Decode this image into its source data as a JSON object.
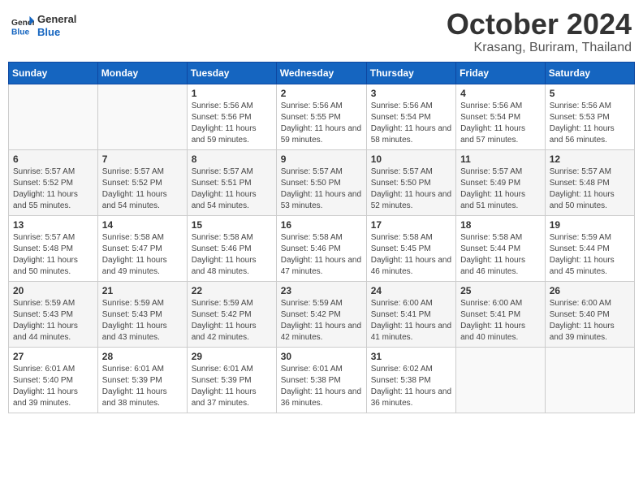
{
  "header": {
    "logo_line1": "General",
    "logo_line2": "Blue",
    "month_year": "October 2024",
    "location": "Krasang, Buriram, Thailand"
  },
  "weekdays": [
    "Sunday",
    "Monday",
    "Tuesday",
    "Wednesday",
    "Thursday",
    "Friday",
    "Saturday"
  ],
  "weeks": [
    [
      {
        "day": "",
        "info": ""
      },
      {
        "day": "",
        "info": ""
      },
      {
        "day": "1",
        "info": "Sunrise: 5:56 AM\nSunset: 5:56 PM\nDaylight: 11 hours and 59 minutes."
      },
      {
        "day": "2",
        "info": "Sunrise: 5:56 AM\nSunset: 5:55 PM\nDaylight: 11 hours and 59 minutes."
      },
      {
        "day": "3",
        "info": "Sunrise: 5:56 AM\nSunset: 5:54 PM\nDaylight: 11 hours and 58 minutes."
      },
      {
        "day": "4",
        "info": "Sunrise: 5:56 AM\nSunset: 5:54 PM\nDaylight: 11 hours and 57 minutes."
      },
      {
        "day": "5",
        "info": "Sunrise: 5:56 AM\nSunset: 5:53 PM\nDaylight: 11 hours and 56 minutes."
      }
    ],
    [
      {
        "day": "6",
        "info": "Sunrise: 5:57 AM\nSunset: 5:52 PM\nDaylight: 11 hours and 55 minutes."
      },
      {
        "day": "7",
        "info": "Sunrise: 5:57 AM\nSunset: 5:52 PM\nDaylight: 11 hours and 54 minutes."
      },
      {
        "day": "8",
        "info": "Sunrise: 5:57 AM\nSunset: 5:51 PM\nDaylight: 11 hours and 54 minutes."
      },
      {
        "day": "9",
        "info": "Sunrise: 5:57 AM\nSunset: 5:50 PM\nDaylight: 11 hours and 53 minutes."
      },
      {
        "day": "10",
        "info": "Sunrise: 5:57 AM\nSunset: 5:50 PM\nDaylight: 11 hours and 52 minutes."
      },
      {
        "day": "11",
        "info": "Sunrise: 5:57 AM\nSunset: 5:49 PM\nDaylight: 11 hours and 51 minutes."
      },
      {
        "day": "12",
        "info": "Sunrise: 5:57 AM\nSunset: 5:48 PM\nDaylight: 11 hours and 50 minutes."
      }
    ],
    [
      {
        "day": "13",
        "info": "Sunrise: 5:57 AM\nSunset: 5:48 PM\nDaylight: 11 hours and 50 minutes."
      },
      {
        "day": "14",
        "info": "Sunrise: 5:58 AM\nSunset: 5:47 PM\nDaylight: 11 hours and 49 minutes."
      },
      {
        "day": "15",
        "info": "Sunrise: 5:58 AM\nSunset: 5:46 PM\nDaylight: 11 hours and 48 minutes."
      },
      {
        "day": "16",
        "info": "Sunrise: 5:58 AM\nSunset: 5:46 PM\nDaylight: 11 hours and 47 minutes."
      },
      {
        "day": "17",
        "info": "Sunrise: 5:58 AM\nSunset: 5:45 PM\nDaylight: 11 hours and 46 minutes."
      },
      {
        "day": "18",
        "info": "Sunrise: 5:58 AM\nSunset: 5:44 PM\nDaylight: 11 hours and 46 minutes."
      },
      {
        "day": "19",
        "info": "Sunrise: 5:59 AM\nSunset: 5:44 PM\nDaylight: 11 hours and 45 minutes."
      }
    ],
    [
      {
        "day": "20",
        "info": "Sunrise: 5:59 AM\nSunset: 5:43 PM\nDaylight: 11 hours and 44 minutes."
      },
      {
        "day": "21",
        "info": "Sunrise: 5:59 AM\nSunset: 5:43 PM\nDaylight: 11 hours and 43 minutes."
      },
      {
        "day": "22",
        "info": "Sunrise: 5:59 AM\nSunset: 5:42 PM\nDaylight: 11 hours and 42 minutes."
      },
      {
        "day": "23",
        "info": "Sunrise: 5:59 AM\nSunset: 5:42 PM\nDaylight: 11 hours and 42 minutes."
      },
      {
        "day": "24",
        "info": "Sunrise: 6:00 AM\nSunset: 5:41 PM\nDaylight: 11 hours and 41 minutes."
      },
      {
        "day": "25",
        "info": "Sunrise: 6:00 AM\nSunset: 5:41 PM\nDaylight: 11 hours and 40 minutes."
      },
      {
        "day": "26",
        "info": "Sunrise: 6:00 AM\nSunset: 5:40 PM\nDaylight: 11 hours and 39 minutes."
      }
    ],
    [
      {
        "day": "27",
        "info": "Sunrise: 6:01 AM\nSunset: 5:40 PM\nDaylight: 11 hours and 39 minutes."
      },
      {
        "day": "28",
        "info": "Sunrise: 6:01 AM\nSunset: 5:39 PM\nDaylight: 11 hours and 38 minutes."
      },
      {
        "day": "29",
        "info": "Sunrise: 6:01 AM\nSunset: 5:39 PM\nDaylight: 11 hours and 37 minutes."
      },
      {
        "day": "30",
        "info": "Sunrise: 6:01 AM\nSunset: 5:38 PM\nDaylight: 11 hours and 36 minutes."
      },
      {
        "day": "31",
        "info": "Sunrise: 6:02 AM\nSunset: 5:38 PM\nDaylight: 11 hours and 36 minutes."
      },
      {
        "day": "",
        "info": ""
      },
      {
        "day": "",
        "info": ""
      }
    ]
  ]
}
